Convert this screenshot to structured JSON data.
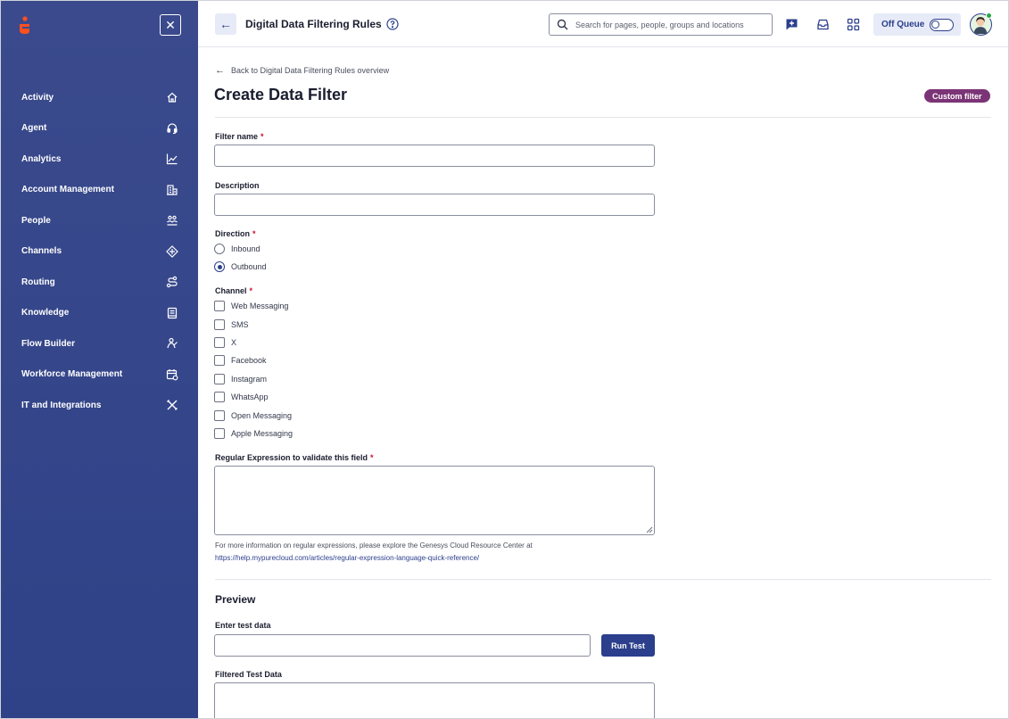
{
  "sidebar": {
    "close_glyph": "✕",
    "items": [
      {
        "label": "Activity",
        "icon": "home-icon"
      },
      {
        "label": "Agent",
        "icon": "headset-icon"
      },
      {
        "label": "Analytics",
        "icon": "chart-line-icon"
      },
      {
        "label": "Account Management",
        "icon": "building-icon"
      },
      {
        "label": "People",
        "icon": "people-icon"
      },
      {
        "label": "Channels",
        "icon": "diamond-arrows-icon"
      },
      {
        "label": "Routing",
        "icon": "route-icon"
      },
      {
        "label": "Knowledge",
        "icon": "book-icon"
      },
      {
        "label": "Flow Builder",
        "icon": "flow-icon"
      },
      {
        "label": "Workforce Management",
        "icon": "calendar-clock-icon"
      },
      {
        "label": "IT and Integrations",
        "icon": "tools-icon"
      }
    ]
  },
  "header": {
    "back_glyph": "←",
    "title": "Digital Data Filtering Rules",
    "search_placeholder": "Search for pages, people, groups and locations",
    "queue_label": "Off Queue",
    "accent": "#2b3f8c"
  },
  "main": {
    "breadcrumb": "Back to Digital Data Filtering Rules overview",
    "breadcrumb_arrow": "←",
    "title": "Create Data Filter",
    "badge": "Custom filter",
    "badge_color": "#7b3476",
    "filter_name_label": "Filter name",
    "description_label": "Description",
    "direction_label": "Direction",
    "direction_options": [
      {
        "label": "Inbound",
        "selected": false
      },
      {
        "label": "Outbound",
        "selected": true
      }
    ],
    "channel_label": "Channel",
    "channels": [
      "Web Messaging",
      "SMS",
      "X",
      "Facebook",
      "Instagram",
      "WhatsApp",
      "Open Messaging",
      "Apple Messaging"
    ],
    "regex_label": "Regular Expression to validate this field",
    "help_line": "For more information on regular expressions, please explore the Genesys Cloud Resource Center at",
    "help_link": "https://help.mypurecloud.com/articles/regular-expression-language-quick-reference/",
    "preview_title": "Preview",
    "test_data_label": "Enter test data",
    "run_test_label": "Run Test",
    "filtered_label": "Filtered Test Data",
    "required_mark": "*"
  }
}
